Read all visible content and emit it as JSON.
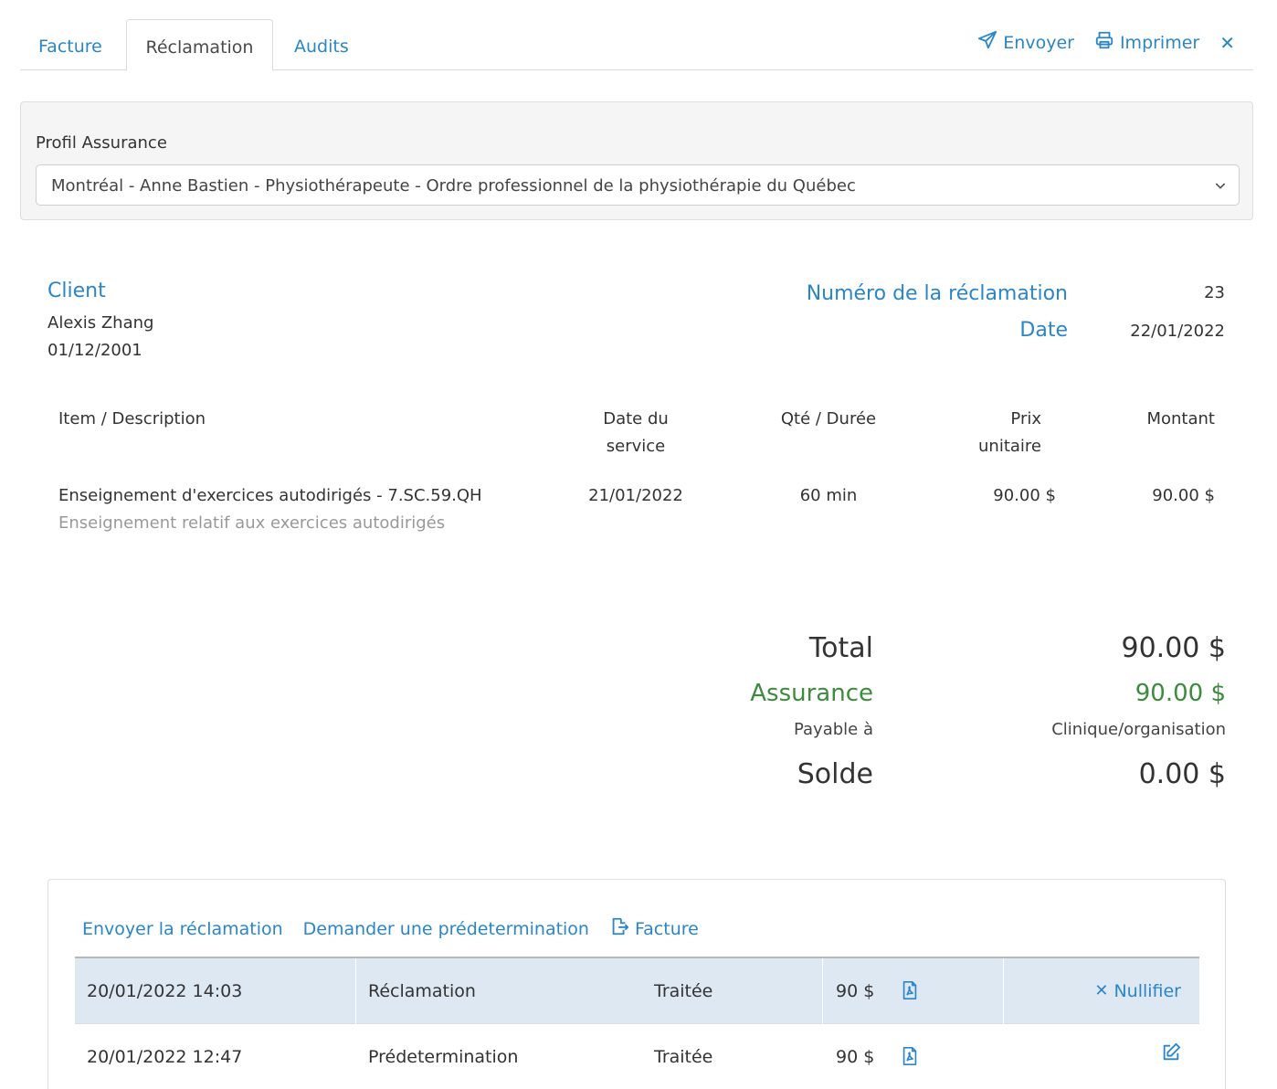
{
  "tabs": [
    {
      "label": "Facture"
    },
    {
      "label": "Réclamation"
    },
    {
      "label": "Audits"
    }
  ],
  "actions": {
    "send_label": "Envoyer",
    "print_label": "Imprimer",
    "close_label": "✕"
  },
  "profile": {
    "label": "Profil Assurance",
    "selected": "Montréal - Anne Bastien - Physiothérapeute - Ordre professionnel de la physiothérapie du Québec"
  },
  "client": {
    "title": "Client",
    "name": "Alexis Zhang",
    "dob": "01/12/2001"
  },
  "claim": {
    "number_label": "Numéro de la réclamation",
    "number": "23",
    "date_label": "Date",
    "date": "22/01/2022"
  },
  "table": {
    "headers": {
      "item": "Item / Description",
      "date": "Date du service",
      "qty": "Qté / Durée",
      "price": "Prix unitaire",
      "amount": "Montant"
    },
    "rows": [
      {
        "item": "Enseignement d'exercices autodirigés - 7.SC.59.QH",
        "description": "Enseignement relatif aux exercices autodirigés",
        "date": "21/01/2022",
        "qty": "60 min",
        "price": "90.00 $",
        "amount": "90.00 $"
      }
    ]
  },
  "totals": {
    "total_label": "Total",
    "total": "90.00 $",
    "insurance_label": "Assurance",
    "insurance": "90.00 $",
    "payable_label": "Payable à",
    "payable": "Clinique/organisation",
    "balance_label": "Solde",
    "balance": "0.00 $"
  },
  "history": {
    "links": {
      "send_claim": "Envoyer la réclamation",
      "predetermination": "Demander une prédetermination",
      "invoice": "Facture"
    },
    "rows": [
      {
        "datetime": "20/01/2022 14:03",
        "type": "Réclamation",
        "status": "Traitée",
        "amount": "90 $",
        "action": "Nullifier"
      },
      {
        "datetime": "20/01/2022 12:47",
        "type": "Prédetermination",
        "status": "Traitée",
        "amount": "90 $",
        "action": ""
      }
    ]
  },
  "colors": {
    "accent": "#2a86c9",
    "insurance_green": "#3d8b3d",
    "selected_row": "#dde8f3"
  }
}
